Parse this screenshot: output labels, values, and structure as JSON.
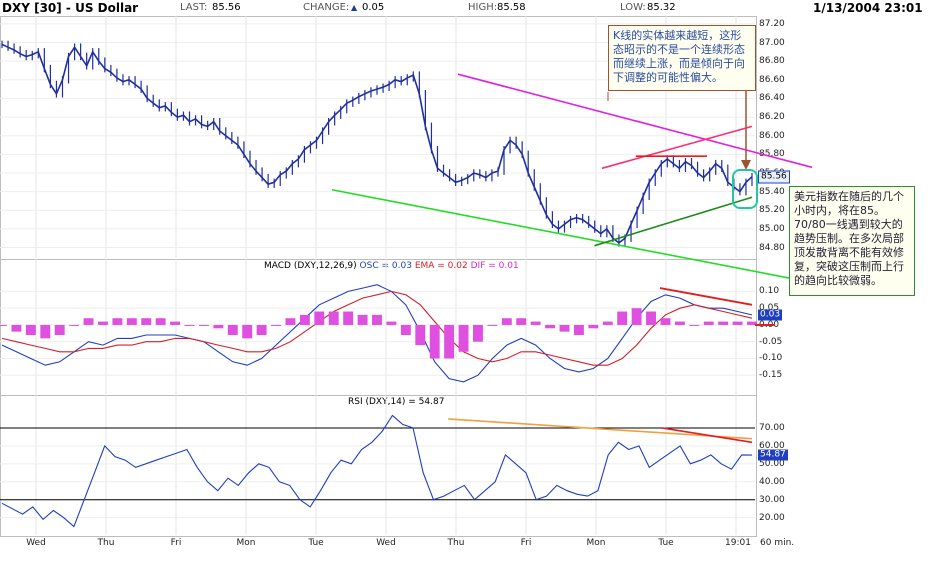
{
  "header": {
    "symbol": "DXY [30] - US Dollar",
    "last_label": "LAST:",
    "last": "85.56",
    "change_label": "CHANGE:",
    "change_arrow": "▲",
    "change": "0.05",
    "high_label": "HIGH:",
    "high": "85.58",
    "low_label": "LOW:",
    "low": "85.32",
    "datetime": "1/13/2004 23:01"
  },
  "annotations": {
    "note1": "K线的实体越来越短，这形态昭示的不是一个连续形态而继续上涨，而是倾向于向下调整的可能性偏大。",
    "note2": "美元指数在随后的几个小时内，将在85。70/80一线遇到较大的趋势压制。在多次局部顶发散背离不能有效修复，突破这压制而上行的趋向比较微弱。"
  },
  "chart_data": [
    {
      "type": "candlestick",
      "title": "DXY [30] - US Dollar",
      "interval": "60 min.",
      "ylim": [
        84.72,
        87.22
      ],
      "y_ticks": [
        "87.20",
        "87.00",
        "86.80",
        "86.60",
        "86.40",
        "86.20",
        "86.00",
        "85.80",
        "85.60",
        "85.40",
        "85.20",
        "85.00",
        "84.80"
      ],
      "last_value": "85.56",
      "x_ticks": [
        "Wed",
        "Thu",
        "Fri",
        "Mon",
        "Tue",
        "Wed",
        "Thu",
        "Fri",
        "Mon",
        "Tue",
        "19:01"
      ],
      "x_unit": "60 min.",
      "series": [
        {
          "name": "DXY",
          "values": [
            86.98,
            86.95,
            86.92,
            86.88,
            86.85,
            86.87,
            86.9,
            86.72,
            86.55,
            86.45,
            86.6,
            86.85,
            86.95,
            86.85,
            86.75,
            86.9,
            86.8,
            86.72,
            86.68,
            86.62,
            86.58,
            86.6,
            86.55,
            86.5,
            86.4,
            86.35,
            86.3,
            86.32,
            86.25,
            86.2,
            86.22,
            86.15,
            86.18,
            86.12,
            86.1,
            86.15,
            86.05,
            86.0,
            85.95,
            85.9,
            85.8,
            85.7,
            85.62,
            85.55,
            85.48,
            85.5,
            85.58,
            85.62,
            85.7,
            85.75,
            85.85,
            85.9,
            85.95,
            86.05,
            86.15,
            86.22,
            86.28,
            86.35,
            86.38,
            86.42,
            86.45,
            86.48,
            86.5,
            86.52,
            86.55,
            86.6,
            86.58,
            86.62,
            86.65,
            86.45,
            86.1,
            85.85,
            85.65,
            85.6,
            85.55,
            85.5,
            85.52,
            85.55,
            85.6,
            85.58,
            85.55,
            85.6,
            85.62,
            85.85,
            85.95,
            85.9,
            85.8,
            85.6,
            85.45,
            85.3,
            85.15,
            85.05,
            85.0,
            85.05,
            85.1,
            85.12,
            85.1,
            85.05,
            85.0,
            84.95,
            85.0,
            84.9,
            84.85,
            84.9,
            85.05,
            85.2,
            85.35,
            85.5,
            85.6,
            85.7,
            85.75,
            85.7,
            85.65,
            85.72,
            85.68,
            85.6,
            85.55,
            85.62,
            85.7,
            85.65,
            85.5,
            85.45,
            85.4,
            85.5,
            85.56
          ]
        }
      ],
      "trendlines": [
        {
          "name": "magenta resistance",
          "color": "#e020e0",
          "from": [
            0.608,
            86.66
          ],
          "to": [
            1.0,
            85.83
          ]
        },
        {
          "name": "green support",
          "color": "#22dd22",
          "from": [
            0.44,
            85.42
          ],
          "to": [
            1.0,
            84.55
          ]
        },
        {
          "name": "pink wedge upper",
          "color": "#ff2d6f",
          "from": [
            0.8,
            85.65
          ],
          "to": [
            1.0,
            86.1
          ]
        },
        {
          "name": "dark green wedge lower",
          "color": "#1a8a1a",
          "from": [
            0.79,
            84.82
          ],
          "to": [
            1.0,
            85.34
          ]
        },
        {
          "name": "red level",
          "color": "#e02020",
          "from": [
            0.845,
            85.78
          ],
          "to": [
            0.94,
            85.78
          ]
        }
      ]
    },
    {
      "type": "line",
      "title": "MACD (DXY,12,26,9)",
      "legend": [
        {
          "label": "OSC = 0.03",
          "color": "#1f3fbf"
        },
        {
          "label": "EMA = 0.02",
          "color": "#d2202a"
        },
        {
          "label": "DIF = 0.01",
          "color": "#d02ad0"
        }
      ],
      "ylim": [
        -0.2,
        0.14
      ],
      "y_ticks": [
        "0.10",
        "0.05",
        "0.00",
        "-0.05",
        "-0.10",
        "-0.15"
      ],
      "last_value": "0.03",
      "series": [
        {
          "name": "OSC",
          "values": [
            -0.06,
            -0.08,
            -0.1,
            -0.12,
            -0.11,
            -0.08,
            -0.05,
            -0.06,
            -0.04,
            -0.04,
            -0.03,
            -0.03,
            -0.03,
            -0.04,
            -0.05,
            -0.08,
            -0.11,
            -0.12,
            -0.1,
            -0.06,
            -0.02,
            0.02,
            0.06,
            0.08,
            0.1,
            0.11,
            0.12,
            0.1,
            0.06,
            -0.02,
            -0.11,
            -0.16,
            -0.17,
            -0.15,
            -0.1,
            -0.06,
            -0.04,
            -0.06,
            -0.1,
            -0.13,
            -0.14,
            -0.13,
            -0.1,
            -0.04,
            0.02,
            0.07,
            0.09,
            0.08,
            0.06,
            0.05,
            0.05,
            0.04,
            0.03
          ]
        },
        {
          "name": "EMA",
          "values": [
            -0.04,
            -0.05,
            -0.06,
            -0.07,
            -0.08,
            -0.08,
            -0.07,
            -0.07,
            -0.06,
            -0.06,
            -0.05,
            -0.05,
            -0.04,
            -0.04,
            -0.05,
            -0.06,
            -0.07,
            -0.08,
            -0.08,
            -0.07,
            -0.05,
            -0.02,
            0.01,
            0.04,
            0.06,
            0.08,
            0.09,
            0.1,
            0.09,
            0.06,
            0.01,
            -0.04,
            -0.08,
            -0.1,
            -0.11,
            -0.1,
            -0.08,
            -0.08,
            -0.09,
            -0.1,
            -0.11,
            -0.12,
            -0.12,
            -0.1,
            -0.06,
            -0.01,
            0.03,
            0.05,
            0.06,
            0.05,
            0.04,
            0.03,
            0.02
          ]
        },
        {
          "name": "DIF",
          "values": [
            0.0,
            -0.02,
            -0.03,
            -0.04,
            -0.03,
            0.0,
            0.02,
            0.01,
            0.02,
            0.02,
            0.02,
            0.02,
            0.01,
            0.0,
            0.0,
            -0.01,
            -0.03,
            -0.04,
            -0.03,
            0.0,
            0.02,
            0.03,
            0.04,
            0.04,
            0.04,
            0.03,
            0.03,
            0.01,
            -0.03,
            -0.06,
            -0.1,
            -0.1,
            -0.08,
            -0.05,
            0.0,
            0.02,
            0.02,
            0.01,
            -0.01,
            -0.02,
            -0.03,
            -0.01,
            0.01,
            0.04,
            0.05,
            0.04,
            0.02,
            0.01,
            0.0,
            0.01,
            0.01,
            0.01,
            0.01
          ]
        }
      ]
    },
    {
      "type": "line",
      "title": "RSI (DXY,14) = 54.87",
      "ylim": [
        12,
        80
      ],
      "y_ticks": [
        "70.00",
        "60.00",
        "50.00",
        "40.00",
        "30.00",
        "20.00"
      ],
      "reference_lines": [
        70,
        30
      ],
      "last_value": "54.87",
      "series": [
        {
          "name": "RSI",
          "values": [
            28,
            25,
            22,
            26,
            19,
            24,
            20,
            15,
            30,
            45,
            60,
            54,
            52,
            48,
            50,
            52,
            54,
            56,
            58,
            48,
            40,
            35,
            42,
            38,
            45,
            50,
            48,
            40,
            38,
            30,
            26,
            35,
            45,
            52,
            50,
            58,
            62,
            68,
            77,
            72,
            70,
            45,
            30,
            32,
            35,
            38,
            30,
            35,
            40,
            55,
            50,
            45,
            30,
            32,
            38,
            35,
            33,
            32,
            35,
            55,
            62,
            58,
            60,
            48,
            52,
            56,
            60,
            50,
            52,
            55,
            50,
            47,
            55,
            54.87
          ]
        }
      ],
      "trendlines": [
        {
          "name": "orange divergence",
          "color": "#f0a040",
          "from": [
            0.595,
            75
          ],
          "to": [
            1.0,
            64
          ]
        },
        {
          "name": "red divergence",
          "color": "#e02020",
          "from": [
            0.88,
            70
          ],
          "to": [
            1.0,
            62
          ]
        }
      ]
    }
  ]
}
